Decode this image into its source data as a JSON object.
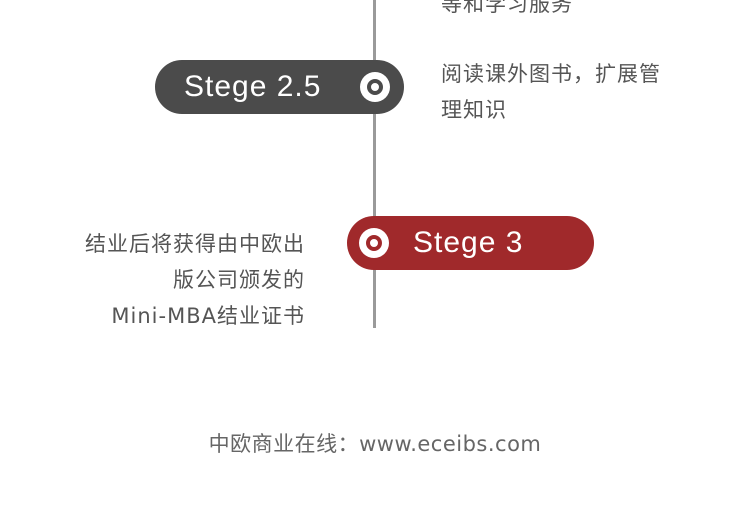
{
  "timeline": {
    "top_cutoff_text": "等和学习服务",
    "stage_25": {
      "label": "Stege 2.5",
      "description_lines": [
        "阅读课外图书，扩展管",
        "理知识"
      ],
      "color": "#4b4b4b"
    },
    "stage_3": {
      "label": "Stege 3",
      "description_lines": [
        "结业后将获得由中欧出",
        "版公司颁发的",
        "Mini-MBA结业证书"
      ],
      "color": "#a0292b"
    },
    "line_color": "#9a9a9a"
  },
  "footer": {
    "text": "中欧商业在线：www.eceibs.com"
  }
}
